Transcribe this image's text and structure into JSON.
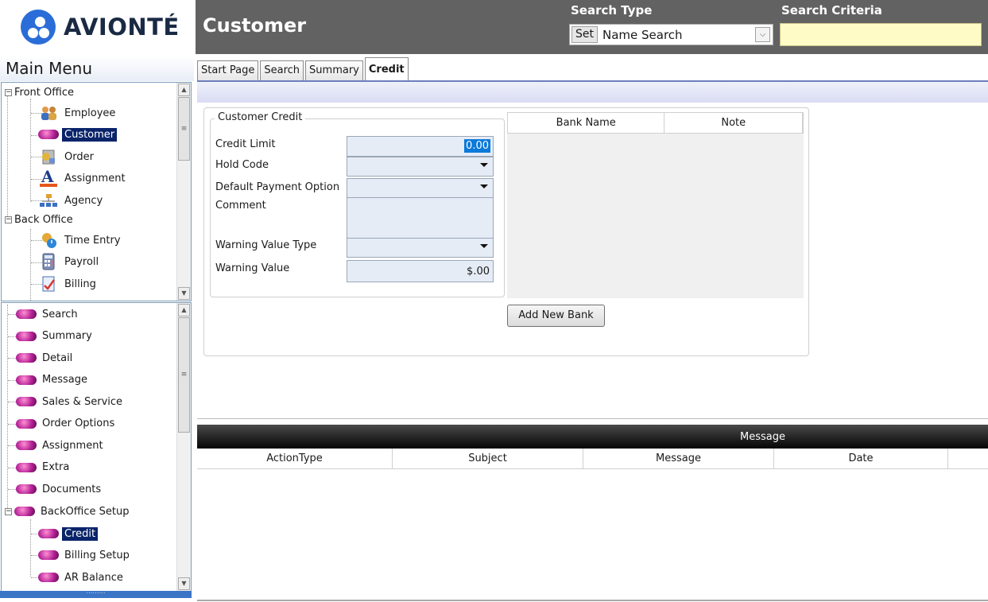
{
  "brand": {
    "name": "AVIONTÉ"
  },
  "header": {
    "page_title": "Customer",
    "search_type_label": "Search Type",
    "search_type_set": "Set",
    "search_type_value": "Name Search",
    "search_criteria_label": "Search Criteria",
    "search_criteria_value": ""
  },
  "menu": {
    "title": "Main Menu",
    "front_office": {
      "label": "Front Office",
      "items": [
        "Employee",
        "Customer",
        "Order",
        "Assignment",
        "Agency"
      ]
    },
    "back_office": {
      "label": "Back Office",
      "items": [
        "Time Entry",
        "Payroll",
        "Billing"
      ]
    },
    "customer_items": [
      "Search",
      "Summary",
      "Detail",
      "Message",
      "Sales & Service",
      "Order Options",
      "Assignment",
      "Extra",
      "Documents"
    ],
    "backoffice_setup": {
      "label": "BackOffice Setup",
      "items": [
        "Credit",
        "Billing Setup",
        "AR Balance"
      ]
    }
  },
  "tabs": [
    "Start Page",
    "Search",
    "Summary",
    "Credit"
  ],
  "credit": {
    "group_title": "Customer Credit",
    "credit_limit_label": "Credit Limit",
    "credit_limit_value": "0.00",
    "hold_code_label": "Hold Code",
    "default_payment_label": "Default Payment Option",
    "comment_label": "Comment",
    "warning_type_label": "Warning Value Type",
    "warning_value_label": "Warning Value",
    "warning_value": "$.00"
  },
  "bank_grid": {
    "columns": [
      "Bank Name",
      "Note"
    ]
  },
  "add_bank_button": "Add New Bank",
  "messages": {
    "title": "Message",
    "columns": [
      "ActionType",
      "Subject",
      "Message",
      "Date"
    ]
  },
  "colors": {
    "topbar": "#626262",
    "selection": "#0a246a",
    "accent": "#0b7ad8",
    "criteria_bg": "#fffbc6"
  }
}
